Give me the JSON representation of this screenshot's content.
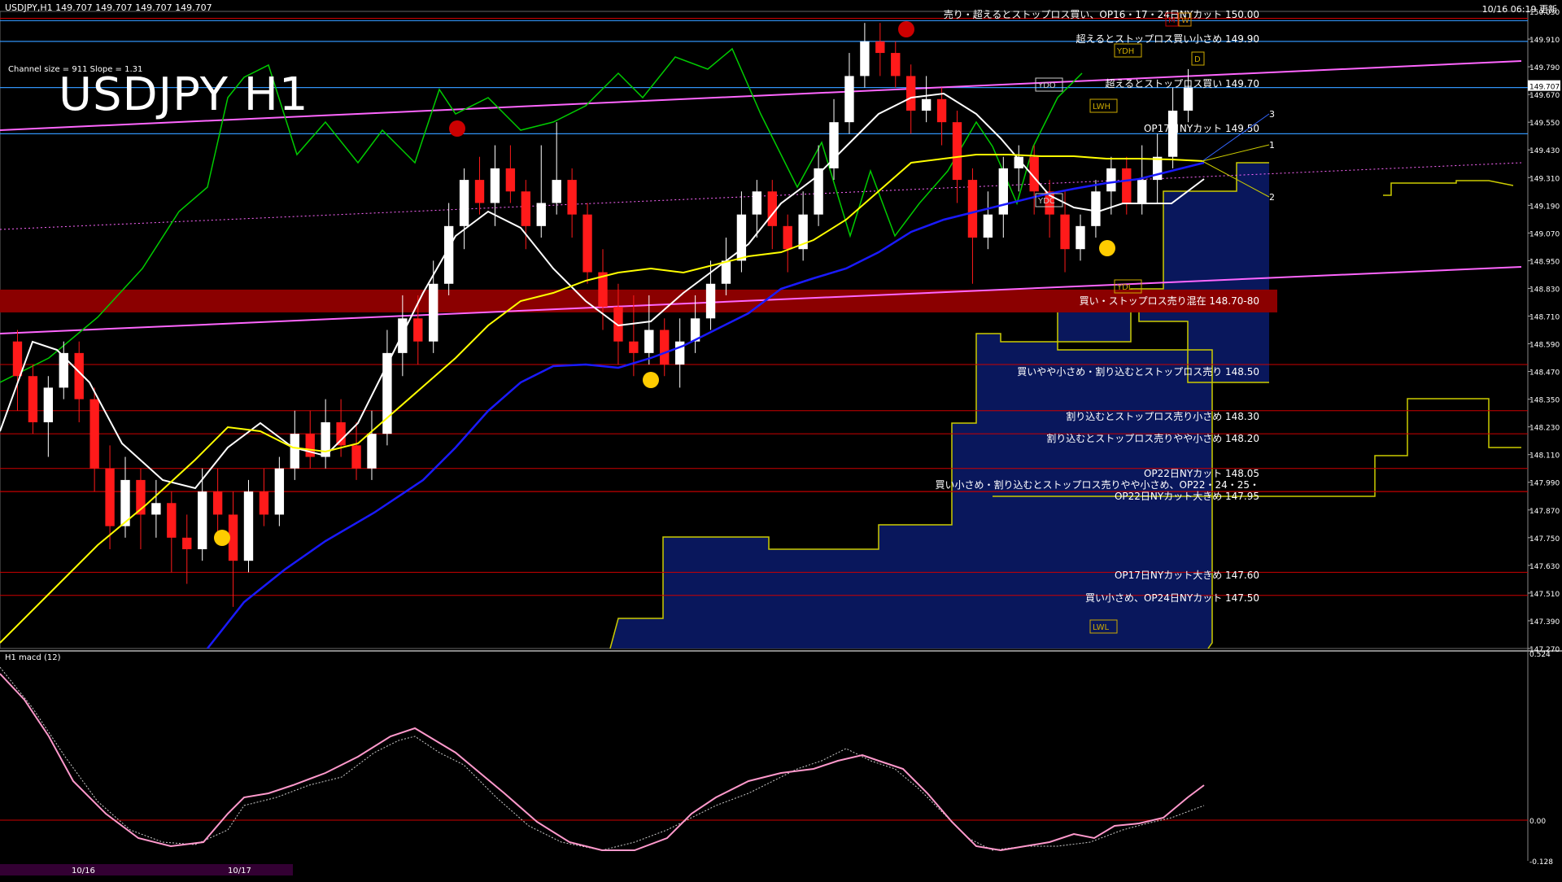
{
  "header": {
    "symbol_info": "USDJPY,H1  149.707 149.707 149.707 149.707",
    "datetime": "10/16 06:19 更新"
  },
  "title": "USDJPY H1",
  "channel_info": "Channel size = 911 Slope = 1.31",
  "macd_label": "H1 macd (12)",
  "colors": {
    "bg": "#000000",
    "up_candle": "#ffffff",
    "down_candle": "#ff1a1a",
    "ma_white": "#ffffff",
    "ma_yellow": "#ffff00",
    "ma_blue": "#1a1aff",
    "chikou_green": "#00cc00",
    "level_line": "#cc0000",
    "blue_line": "#3399ff",
    "channel": "#ff66ff",
    "cloud_fill": "#0a1a66",
    "zone": "#8b0000",
    "macd_pink": "#ff99cc",
    "macd_green": "#33ff33"
  },
  "chart_data": {
    "type": "candlestick",
    "symbol": "USDJPY",
    "timeframe": "H1",
    "yrange": [
      147.27,
      150.03
    ],
    "y_ticks": [
      "150.030",
      "149.910",
      "149.790",
      "149.670",
      "149.550",
      "149.430",
      "149.310",
      "149.190",
      "149.070",
      "148.950",
      "148.830",
      "148.710",
      "148.590",
      "148.470",
      "148.350",
      "148.230",
      "148.110",
      "147.990",
      "147.870",
      "147.750",
      "147.630",
      "147.510",
      "147.390",
      "147.270"
    ],
    "current_price": "149.707",
    "candles": [
      [
        148.6,
        148.45,
        148.65,
        148.3
      ],
      [
        148.45,
        148.25,
        148.5,
        148.2
      ],
      [
        148.25,
        148.4,
        148.45,
        148.1
      ],
      [
        148.4,
        148.55,
        148.6,
        148.35
      ],
      [
        148.55,
        148.35,
        148.6,
        148.25
      ],
      [
        148.35,
        148.05,
        148.4,
        147.95
      ],
      [
        148.05,
        147.8,
        148.15,
        147.7
      ],
      [
        147.8,
        148.0,
        148.1,
        147.75
      ],
      [
        148.0,
        147.85,
        148.05,
        147.7
      ],
      [
        147.85,
        147.9,
        148.0,
        147.75
      ],
      [
        147.9,
        147.75,
        147.95,
        147.6
      ],
      [
        147.75,
        147.7,
        147.85,
        147.55
      ],
      [
        147.7,
        147.95,
        148.05,
        147.65
      ],
      [
        147.95,
        147.85,
        148.05,
        147.75
      ],
      [
        147.85,
        147.65,
        147.95,
        147.45
      ],
      [
        147.65,
        147.95,
        148.0,
        147.6
      ],
      [
        147.95,
        147.85,
        148.05,
        147.8
      ],
      [
        147.85,
        148.05,
        148.1,
        147.8
      ],
      [
        148.05,
        148.2,
        148.3,
        148.0
      ],
      [
        148.2,
        148.1,
        148.3,
        148.05
      ],
      [
        148.1,
        148.25,
        148.35,
        148.05
      ],
      [
        148.25,
        148.15,
        148.35,
        148.1
      ],
      [
        148.15,
        148.05,
        148.25,
        148.0
      ],
      [
        148.05,
        148.2,
        148.3,
        148.0
      ],
      [
        148.2,
        148.55,
        148.65,
        148.15
      ],
      [
        148.55,
        148.7,
        148.8,
        148.45
      ],
      [
        148.7,
        148.6,
        148.8,
        148.5
      ],
      [
        148.6,
        148.85,
        148.95,
        148.55
      ],
      [
        148.85,
        149.1,
        149.2,
        148.8
      ],
      [
        149.1,
        149.3,
        149.35,
        149.0
      ],
      [
        149.3,
        149.2,
        149.4,
        149.15
      ],
      [
        149.2,
        149.35,
        149.45,
        149.1
      ],
      [
        149.35,
        149.25,
        149.45,
        149.2
      ],
      [
        149.25,
        149.1,
        149.3,
        149.0
      ],
      [
        149.1,
        149.2,
        149.45,
        149.05
      ],
      [
        149.2,
        149.3,
        149.55,
        149.15
      ],
      [
        149.3,
        149.15,
        149.35,
        149.05
      ],
      [
        149.15,
        148.9,
        149.2,
        148.85
      ],
      [
        148.9,
        148.75,
        149.0,
        148.65
      ],
      [
        148.75,
        148.6,
        148.85,
        148.5
      ],
      [
        148.6,
        148.55,
        148.8,
        148.45
      ],
      [
        148.55,
        148.65,
        148.8,
        148.5
      ],
      [
        148.65,
        148.5,
        148.7,
        148.45
      ],
      [
        148.5,
        148.6,
        148.7,
        148.4
      ],
      [
        148.6,
        148.7,
        148.8,
        148.55
      ],
      [
        148.7,
        148.85,
        148.95,
        148.65
      ],
      [
        148.85,
        148.95,
        149.05,
        148.8
      ],
      [
        148.95,
        149.15,
        149.25,
        148.9
      ],
      [
        149.15,
        149.25,
        149.3,
        149.05
      ],
      [
        149.25,
        149.1,
        149.3,
        149.0
      ],
      [
        149.1,
        149.0,
        149.15,
        148.9
      ],
      [
        149.0,
        149.15,
        149.25,
        148.95
      ],
      [
        149.15,
        149.35,
        149.45,
        149.1
      ],
      [
        149.35,
        149.55,
        149.65,
        149.3
      ],
      [
        149.55,
        149.75,
        149.85,
        149.5
      ],
      [
        149.75,
        149.9,
        149.98,
        149.7
      ],
      [
        149.9,
        149.85,
        149.98,
        149.75
      ],
      [
        149.85,
        149.75,
        149.9,
        149.7
      ],
      [
        149.75,
        149.6,
        149.8,
        149.5
      ],
      [
        149.6,
        149.65,
        149.75,
        149.55
      ],
      [
        149.65,
        149.55,
        149.7,
        149.45
      ],
      [
        149.55,
        149.3,
        149.6,
        149.2
      ],
      [
        149.3,
        149.05,
        149.35,
        148.85
      ],
      [
        149.05,
        149.15,
        149.25,
        149.0
      ],
      [
        149.15,
        149.35,
        149.4,
        149.05
      ],
      [
        149.35,
        149.4,
        149.45,
        149.25
      ],
      [
        149.4,
        149.25,
        149.45,
        149.15
      ],
      [
        149.25,
        149.15,
        149.3,
        149.05
      ],
      [
        149.15,
        149.0,
        149.25,
        148.9
      ],
      [
        149.0,
        149.1,
        149.15,
        148.95
      ],
      [
        149.1,
        149.25,
        149.3,
        149.05
      ],
      [
        149.25,
        149.35,
        149.4,
        149.15
      ],
      [
        149.35,
        149.2,
        149.4,
        149.15
      ],
      [
        149.2,
        149.3,
        149.45,
        149.15
      ],
      [
        149.3,
        149.4,
        149.5,
        149.2
      ],
      [
        149.4,
        149.6,
        149.7,
        149.35
      ],
      [
        149.6,
        149.7,
        149.78,
        149.55
      ]
    ],
    "levels": [
      {
        "price": 150.0,
        "label": "売り・超えるとストップロス買い、OP16・17・24日NYカット 150.00",
        "color": "#cc0000"
      },
      {
        "price": 149.9,
        "label": "超えるとストップロス買い小さめ 149.90",
        "color": "#3399ff"
      },
      {
        "price": 149.7,
        "label": "超えるとストップロス買い 149.70",
        "color": "#3399ff"
      },
      {
        "price": 149.5,
        "label": "OP17日NYカット 149.50",
        "color": "#3399ff"
      },
      {
        "price": 148.5,
        "label": "買いやや小さめ・割り込むとストップロス売り 148.50",
        "color": "#cc0000"
      },
      {
        "price": 148.3,
        "label": "割り込むとストップロス売り小さめ 148.30",
        "color": "#cc0000"
      },
      {
        "price": 148.2,
        "label": "割り込むとストップロス売りやや小さめ 148.20",
        "color": "#cc0000"
      },
      {
        "price": 148.05,
        "label": "OP22日NYカット 148.05",
        "color": "#cc0000"
      },
      {
        "price": 147.95,
        "label": "買い小さめ・割り込むとストップロス売りやや小さめ、OP22・24・25・",
        "color": "#cc0000"
      },
      {
        "price": 147.95,
        "label": "OP22日NYカット大きめ 147.95",
        "color": "#cc0000"
      },
      {
        "price": 147.6,
        "label": "OP17日NYカット大きめ 147.60",
        "color": "#cc0000"
      },
      {
        "price": 147.5,
        "label": "買い小さめ、OP24日NYカット 147.50",
        "color": "#cc0000"
      }
    ],
    "zone": {
      "from": 148.7,
      "to": 148.8,
      "label": "買い・ストップロス売り混在 148.70-80"
    },
    "marker_labels": [
      "YDH",
      "YDO",
      "YDC",
      "YDL",
      "LWH",
      "LWL",
      "M",
      "W",
      "D",
      "1",
      "2",
      "3"
    ],
    "macd": {
      "y_ticks": [
        "0.524",
        "0.00",
        "-0.128"
      ],
      "yrange": [
        -0.128,
        0.524
      ]
    },
    "bottom_dates": [
      "10/16",
      "10/17"
    ]
  }
}
